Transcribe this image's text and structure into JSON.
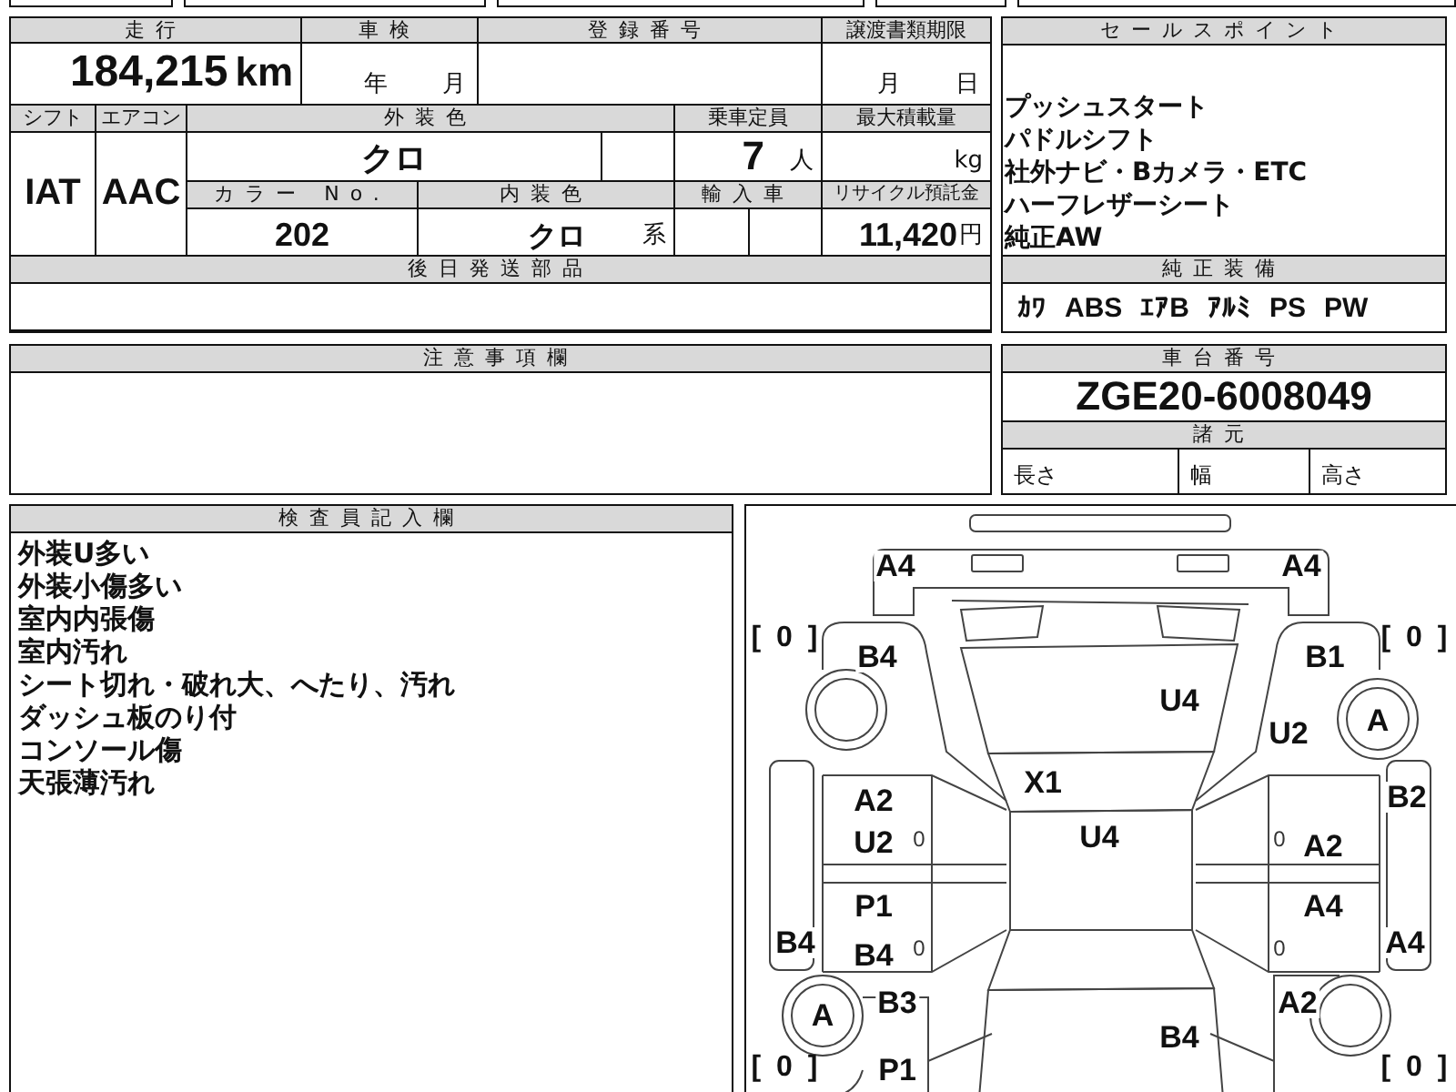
{
  "vehicle_table": {
    "mileage": {
      "label": "走行",
      "value": "184,215",
      "unit": "km"
    },
    "inspection": {
      "label": "車検",
      "year_unit": "年",
      "month_unit": "月"
    },
    "registration": {
      "label": "登録番号"
    },
    "transfer_deadline": {
      "label": "譲渡書類期限",
      "month_unit": "月",
      "day_unit": "日"
    },
    "shift": {
      "label": "シフト",
      "value": "IAT"
    },
    "aircon": {
      "label": "エアコン",
      "value": "AAC"
    },
    "exterior_color": {
      "label": "外装色",
      "value": "クロ"
    },
    "capacity": {
      "label": "乗車定員",
      "value": "7",
      "unit": "人"
    },
    "max_load": {
      "label": "最大積載量",
      "unit": "kg"
    },
    "color_no": {
      "label": "カラー No.",
      "value": "202"
    },
    "interior_color": {
      "label": "内装色",
      "value": "クロ",
      "suffix": "系"
    },
    "imported": {
      "label": "輸入車"
    },
    "recycle_fee": {
      "label": "リサイクル預託金",
      "value": "11,420",
      "unit": "円"
    },
    "later_parts": {
      "label": "後日発送部品"
    }
  },
  "sales_points": {
    "label": "セールスポイント",
    "lines": [
      "プッシュスタート",
      "パドルシフト",
      "社外ナビ・Bカメラ・ETC",
      "ハーフレザーシート",
      "純正AW"
    ]
  },
  "standard_equipment": {
    "label": "純正装備",
    "items": [
      "ｶﾜ",
      "ABS",
      "ｴｱB",
      "ｱﾙﾐ",
      "PS",
      "PW"
    ]
  },
  "chassis": {
    "label": "車台番号",
    "value": "ZGE20-6008049"
  },
  "specs": {
    "label": "諸元",
    "fields": [
      "長さ",
      "幅",
      "高さ"
    ]
  },
  "notes": {
    "label": "注意事項欄"
  },
  "inspector_notes": {
    "label": "検査員記入欄",
    "lines": [
      "外装U多い",
      "外装小傷多い",
      "室内内張傷",
      "室内汚れ",
      "シート切れ・破れ大、へたり、汚れ",
      "ダッシュ板のり付",
      "コンソール傷",
      "天張薄汚れ"
    ]
  },
  "diagram": {
    "marks": [
      {
        "text": "A4",
        "kind": "code"
      },
      {
        "text": "A4",
        "kind": "code"
      },
      {
        "text": "[ 0 ]",
        "kind": "count"
      },
      {
        "text": "B4",
        "kind": "code"
      },
      {
        "text": "B1",
        "kind": "code"
      },
      {
        "text": "[ 0 ]",
        "kind": "count"
      },
      {
        "text": "U4",
        "kind": "code"
      },
      {
        "text": "A",
        "kind": "tire"
      },
      {
        "text": "U2",
        "kind": "code"
      },
      {
        "text": "X1",
        "kind": "code"
      },
      {
        "text": "A2",
        "kind": "code"
      },
      {
        "text": "B2",
        "kind": "code"
      },
      {
        "text": "U2",
        "kind": "code"
      },
      {
        "text": "0",
        "kind": "door"
      },
      {
        "text": "U4",
        "kind": "code"
      },
      {
        "text": "0",
        "kind": "door"
      },
      {
        "text": "A2",
        "kind": "code"
      },
      {
        "text": "P1",
        "kind": "code"
      },
      {
        "text": "A4",
        "kind": "code"
      },
      {
        "text": "B4",
        "kind": "code"
      },
      {
        "text": "B4",
        "kind": "code"
      },
      {
        "text": "0",
        "kind": "door"
      },
      {
        "text": "0",
        "kind": "door"
      },
      {
        "text": "A4",
        "kind": "code"
      },
      {
        "text": "A",
        "kind": "tire"
      },
      {
        "text": "B3",
        "kind": "code"
      },
      {
        "text": "A2",
        "kind": "code"
      },
      {
        "text": "B4",
        "kind": "code"
      },
      {
        "text": "[ 0 ]",
        "kind": "count"
      },
      {
        "text": "P1",
        "kind": "code"
      },
      {
        "text": "[ 0 ]",
        "kind": "count"
      }
    ]
  }
}
